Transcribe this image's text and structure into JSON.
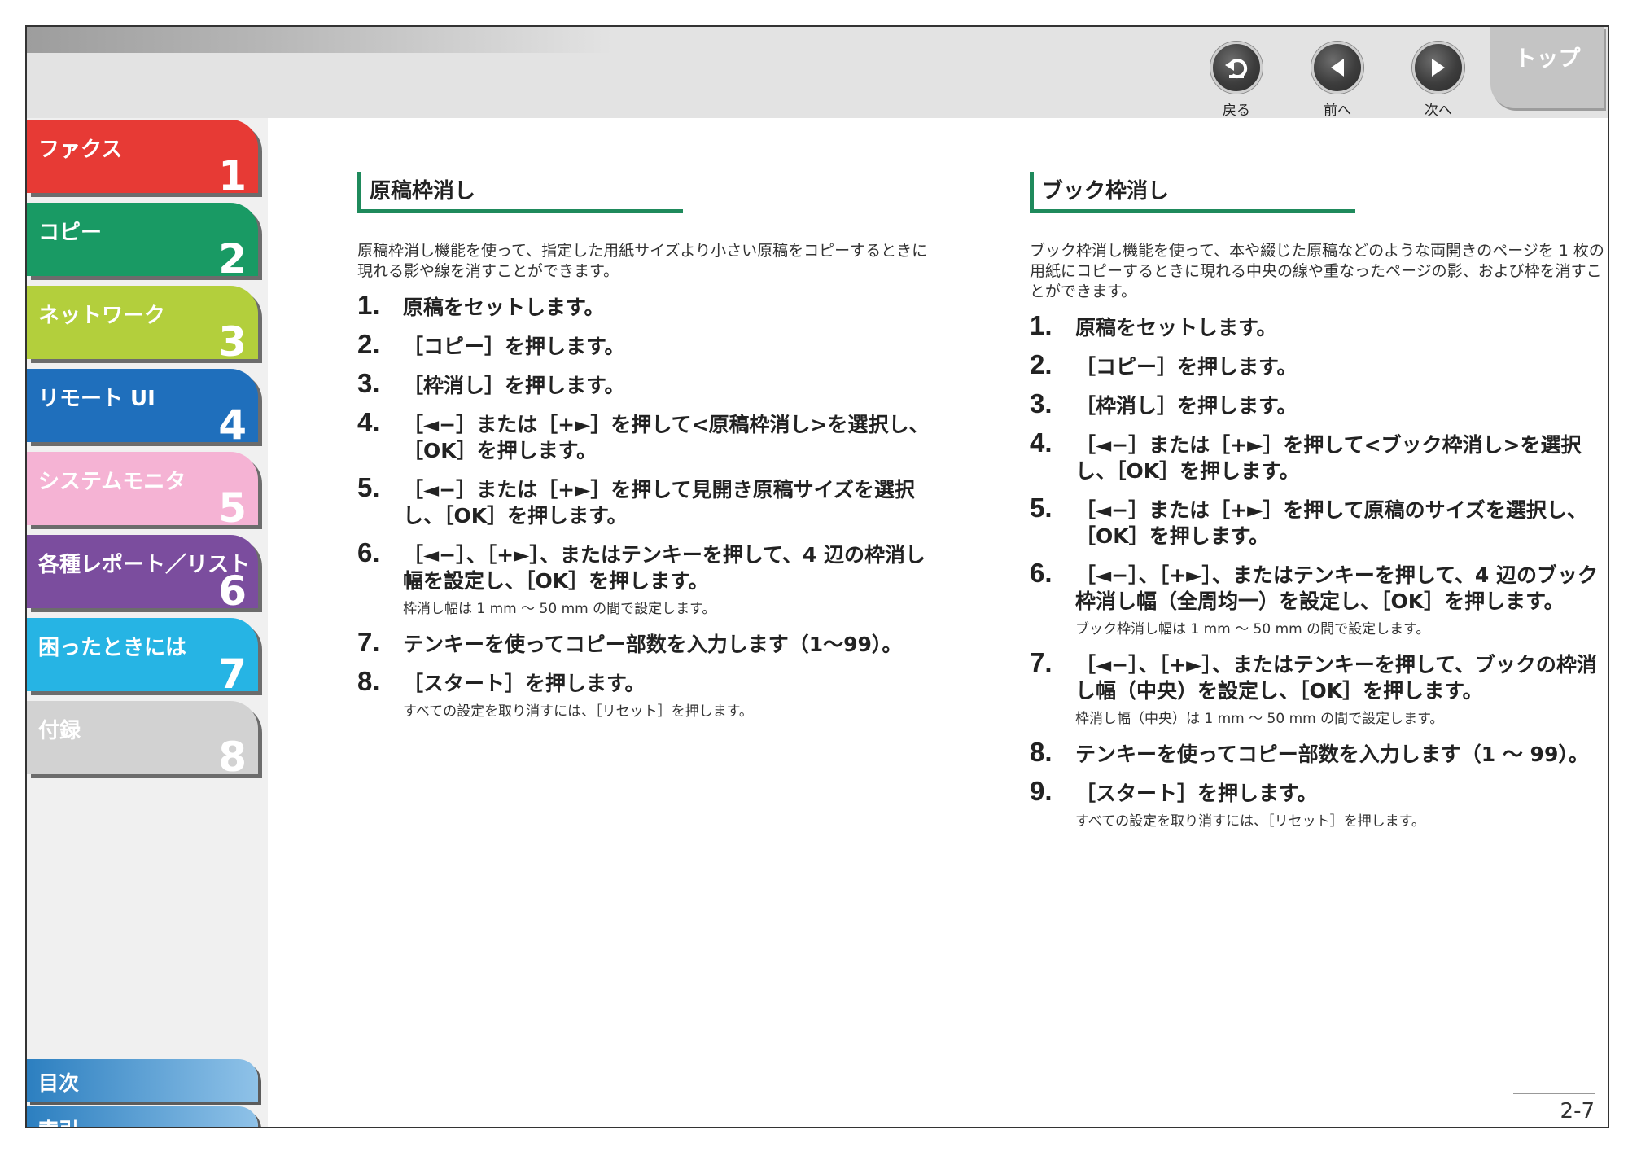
{
  "nav": {
    "back_label": "戻る",
    "prev_label": "前へ",
    "next_label": "次へ",
    "top_label": "トップ"
  },
  "chapters": [
    {
      "title": "ファクス",
      "number": "1",
      "color": "#e73a35"
    },
    {
      "title": "コピー",
      "number": "2",
      "color": "#199a64"
    },
    {
      "title": "ネットワーク",
      "number": "3",
      "color": "#b3cf3c"
    },
    {
      "title": "リモート UI",
      "number": "4",
      "color": "#1f6fbc"
    },
    {
      "title": "システムモニタ",
      "number": "5",
      "color": "#f5b3d4"
    },
    {
      "title": "各種レポート／リスト",
      "number": "6",
      "color": "#7b4d9e"
    },
    {
      "title": "困ったときには",
      "number": "7",
      "color": "#26b4e4"
    },
    {
      "title": "付録",
      "number": "8",
      "color": "#d2d2d2"
    }
  ],
  "bottom_links": {
    "contents_label": "目次",
    "index_label": "索引"
  },
  "left_section": {
    "title": "原稿枠消し",
    "description": "原稿枠消し機能を使って、指定した用紙サイズより小さい原稿をコピーするときに現れる影や線を消すことができます。",
    "steps": [
      {
        "num": "1.",
        "text": "原稿をセットします。",
        "note": ""
      },
      {
        "num": "2.",
        "text": "［コピー］を押します。",
        "note": ""
      },
      {
        "num": "3.",
        "text": "［枠消し］を押します。",
        "note": ""
      },
      {
        "num": "4.",
        "text": "［◄−］または［+►］を押して<原稿枠消し>を選択し、［OK］を押します。",
        "note": ""
      },
      {
        "num": "5.",
        "text": "［◄−］または［+►］を押して見開き原稿サイズを選択し、［OK］を押します。",
        "note": ""
      },
      {
        "num": "6.",
        "text": "［◄−］、［+►］、またはテンキーを押して、4 辺の枠消し幅を設定し、［OK］を押します。",
        "note": "枠消し幅は 1 mm ～ 50 mm の間で設定します。"
      },
      {
        "num": "7.",
        "text": "テンキーを使ってコピー部数を入力します（1～99）。",
        "note": ""
      },
      {
        "num": "8.",
        "text": "［スタート］を押します。",
        "note": "すべての設定を取り消すには、［リセット］を押します。"
      }
    ]
  },
  "right_section": {
    "title": "ブック枠消し",
    "description": "ブック枠消し機能を使って、本や綴じた原稿などのような両開きのページを 1 枚の用紙にコピーするときに現れる中央の線や重なったページの影、および枠を消すことができます。",
    "steps": [
      {
        "num": "1.",
        "text": "原稿をセットします。",
        "note": ""
      },
      {
        "num": "2.",
        "text": "［コピー］を押します。",
        "note": ""
      },
      {
        "num": "3.",
        "text": "［枠消し］を押します。",
        "note": ""
      },
      {
        "num": "4.",
        "text": "［◄−］または［+►］を押して<ブック枠消し>を選択し、［OK］を押します。",
        "note": ""
      },
      {
        "num": "5.",
        "text": "［◄−］または［+►］を押して原稿のサイズを選択し、［OK］を押します。",
        "note": ""
      },
      {
        "num": "6.",
        "text": "［◄−］、［+►］、またはテンキーを押して、4 辺のブック枠消し幅（全周均一）を設定し、［OK］を押します。",
        "note": "ブック枠消し幅は 1 mm ～ 50 mm の間で設定します。"
      },
      {
        "num": "7.",
        "text": "［◄−］、［+►］、またはテンキーを押して、ブックの枠消し幅（中央）を設定し、［OK］を押します。",
        "note": "枠消し幅（中央）は 1 mm ～ 50 mm の間で設定します。"
      },
      {
        "num": "8.",
        "text": "テンキーを使ってコピー部数を入力します（1 ～ 99）。",
        "note": ""
      },
      {
        "num": "9.",
        "text": "［スタート］を押します。",
        "note": "すべての設定を取り消すには、［リセット］を押します。"
      }
    ]
  },
  "page_number": "2-7"
}
